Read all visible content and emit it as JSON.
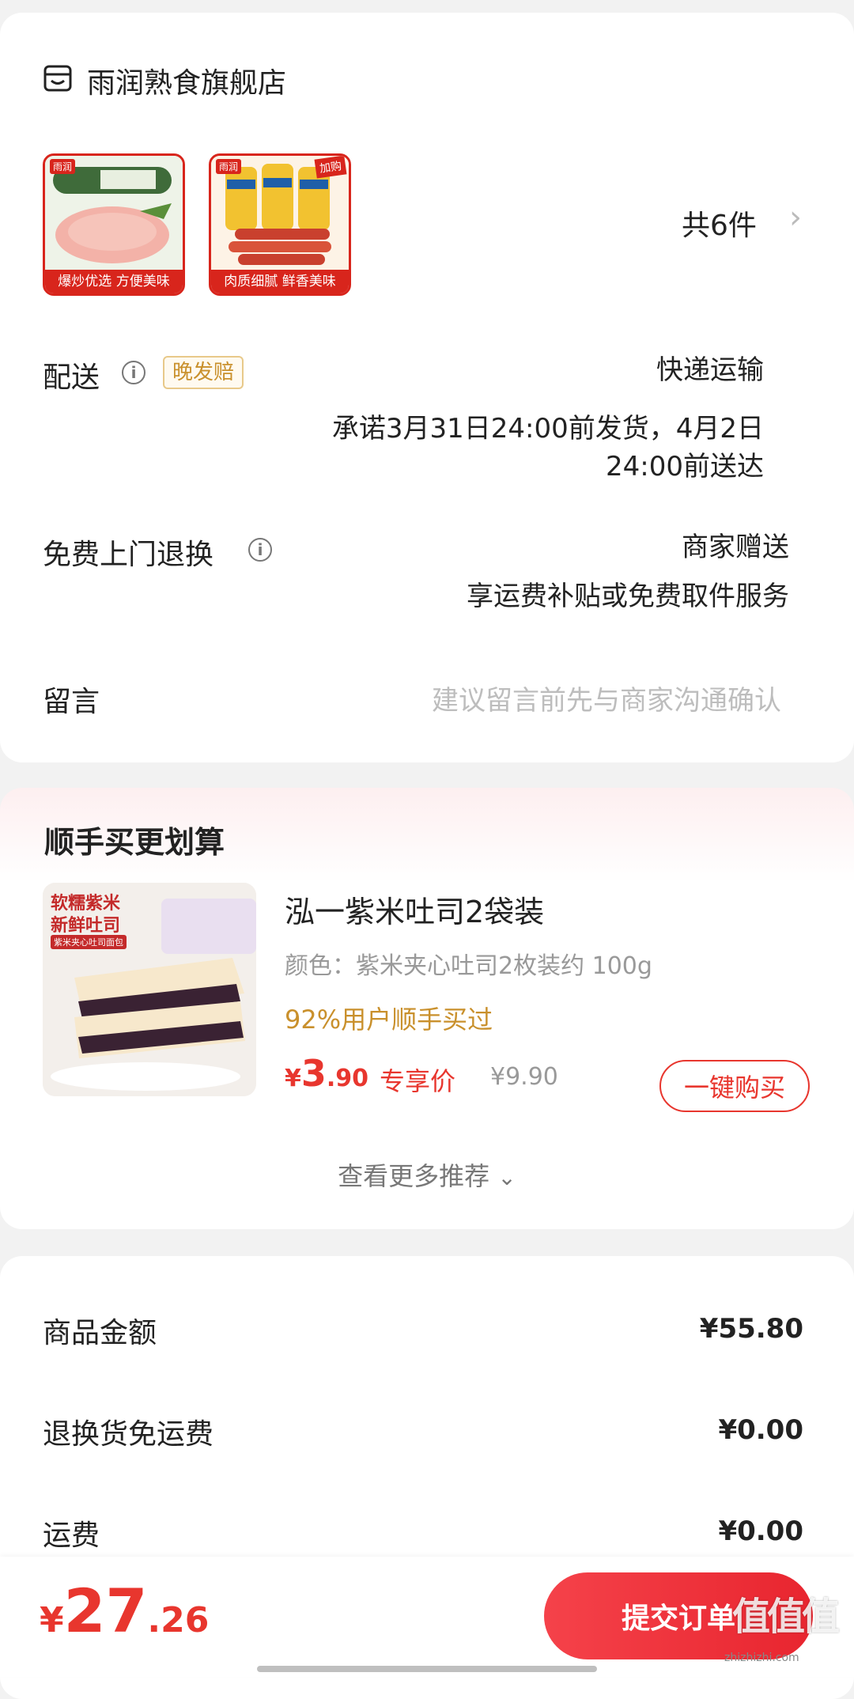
{
  "store": {
    "name": "雨润熟食旗舰店",
    "icon": "store-icon"
  },
  "products": {
    "count_label": "共6件",
    "thumbs": [
      {
        "brand": "雨润",
        "band": "爆炒优选 方便美味"
      },
      {
        "brand": "雨润",
        "tag": "加购",
        "band": "肉质细腻 鲜香美味"
      }
    ]
  },
  "delivery": {
    "label": "配送",
    "badge": "晚发赔",
    "method": "快递运输",
    "promise_line1": "承诺3月31日24:00前发货，4月2日",
    "promise_line2": "24:00前送达"
  },
  "returns": {
    "label": "免费上门退换",
    "line1": "商家赠送",
    "line2": "享运费补贴或免费取件服务"
  },
  "message": {
    "label": "留言",
    "placeholder": "建议留言前先与商家沟通确认"
  },
  "reco": {
    "title": "顺手买更划算",
    "item": {
      "img_text1": "软糯紫米",
      "img_text2": "新鲜吐司",
      "img_text3": "紫米夹心吐司面包",
      "name": "泓一紫米吐司2袋装",
      "spec": "颜色：紫米夹心吐司2枚装约 100g",
      "social": "92%用户顺手买过",
      "price_symbol": "¥",
      "price_int": "3",
      "price_dec": ".90",
      "price_tag": "专享价",
      "orig_price": "¥9.90",
      "buy_label": "一键购买"
    },
    "more_label": "查看更多推荐"
  },
  "summary": {
    "rows": [
      {
        "label": "商品金额",
        "value": "¥55.80"
      },
      {
        "label": "退换货免运费",
        "value": "¥0.00"
      },
      {
        "label": "运费",
        "value": "¥0.00"
      }
    ]
  },
  "footer": {
    "total_symbol": "¥",
    "total_int": "27",
    "total_dec": ".26",
    "submit_label": "提交订单",
    "watermark": "值值值",
    "watermark_url": "zhizhizhi.com"
  },
  "colors": {
    "accent": "#e8362e",
    "gold": "#c9902c",
    "brand_red": "#d8251c"
  }
}
